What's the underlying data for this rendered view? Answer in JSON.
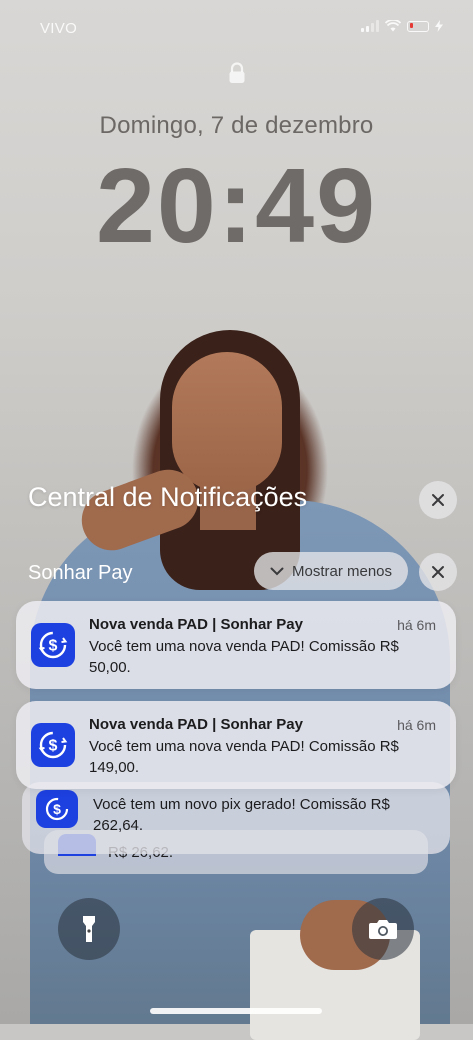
{
  "status_bar": {
    "carrier": "VIVO"
  },
  "lock_screen": {
    "date": "Domingo, 7 de dezembro",
    "time": "20:49"
  },
  "notification_center": {
    "title": "Central de Notificações",
    "app_group": "Sonhar Pay",
    "show_less_label": "Mostrar menos"
  },
  "notifications": [
    {
      "title": "Nova venda PAD | Sonhar Pay",
      "time": "há 6m",
      "body": "Você tem uma nova venda PAD! Comissão R$ 50,00."
    },
    {
      "title": "Nova venda PAD | Sonhar Pay",
      "time": "há 6m",
      "body": "Você tem uma nova venda PAD! Comissão R$ 149,00."
    },
    {
      "body": "Você tem um novo pix gerado! Comissão R$ 262,64."
    },
    {
      "body": "R$ 26,62."
    }
  ],
  "colors": {
    "app_icon": "#1d40e0",
    "battery_low": "#e53935"
  },
  "icons": {
    "app": "dollar-cycle-icon",
    "flashlight": "flashlight-icon",
    "camera": "camera-icon",
    "lock": "lock-icon"
  }
}
